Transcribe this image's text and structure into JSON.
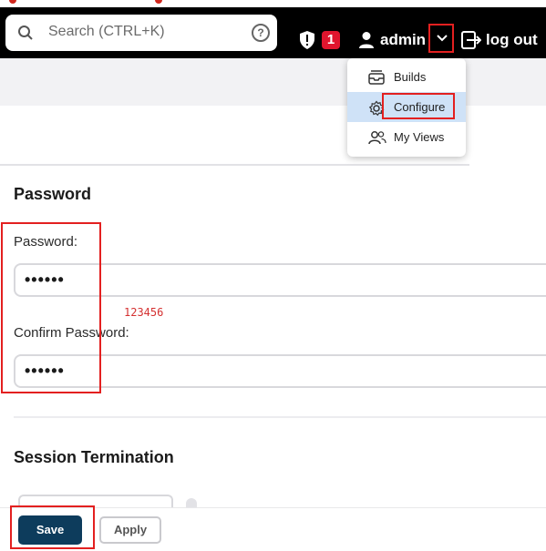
{
  "header": {
    "search_placeholder": "Search (CTRL+K)",
    "help_icon_label": "?",
    "notification_count": "1",
    "username": "admin",
    "logout_label": "log out"
  },
  "dropdown": {
    "items": [
      {
        "label": "Builds",
        "icon": "builds-icon"
      },
      {
        "label": "Configure",
        "icon": "gear-icon",
        "active": true
      },
      {
        "label": "My Views",
        "icon": "people-icon"
      }
    ]
  },
  "password_section": {
    "title": "Password",
    "password_label": "Password:",
    "password_value": "••••••",
    "confirm_label": "Confirm Password:",
    "confirm_value": "••••••",
    "annotation": "123456"
  },
  "session_section": {
    "title": "Session Termination"
  },
  "footer": {
    "save_label": "Save",
    "apply_label": "Apply"
  },
  "colors": {
    "header_bg": "#000000",
    "save_bg": "#0d3c5c",
    "badge_red": "#e0152e",
    "highlight_box": "#e32020",
    "active_item_bg": "#cfe2f7"
  }
}
